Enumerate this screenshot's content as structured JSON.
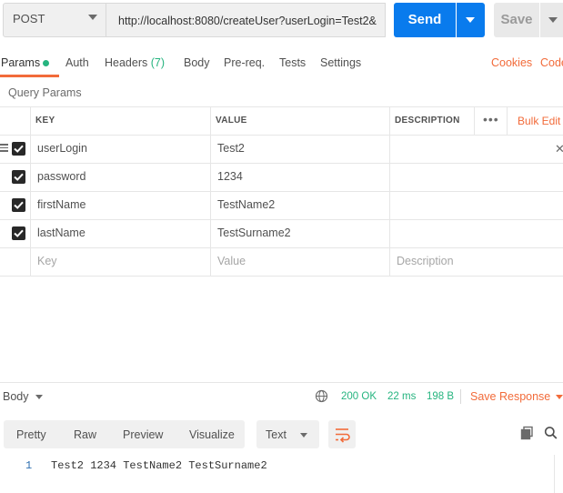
{
  "request": {
    "method": "POST",
    "url": "http://localhost:8080/createUser?userLogin=Test2&",
    "send_label": "Send",
    "save_label": "Save"
  },
  "tabs": {
    "params": "Params",
    "auth": "Auth",
    "headers": "Headers",
    "headers_count": "(7)",
    "body": "Body",
    "prereq": "Pre-req.",
    "tests": "Tests",
    "settings": "Settings",
    "cookies": "Cookies",
    "code": "Code"
  },
  "query_params": {
    "title": "Query Params",
    "columns": {
      "key": "KEY",
      "value": "VALUE",
      "description": "DESCRIPTION"
    },
    "bulk_edit": "Bulk Edit",
    "rows": [
      {
        "key": "userLogin",
        "value": "Test2",
        "checked": true
      },
      {
        "key": "password",
        "value": "1234",
        "checked": true
      },
      {
        "key": "firstName",
        "value": "TestName2",
        "checked": true
      },
      {
        "key": "lastName",
        "value": "TestSurname2",
        "checked": true
      }
    ],
    "placeholders": {
      "key": "Key",
      "value": "Value",
      "description": "Description"
    }
  },
  "response": {
    "body_label": "Body",
    "status": "200 OK",
    "time": "22 ms",
    "size": "198 B",
    "save_response": "Save Response",
    "views": {
      "pretty": "Pretty",
      "raw": "Raw",
      "preview": "Preview",
      "visualize": "Visualize"
    },
    "format": "Text",
    "line_number": "1",
    "content": "Test2 1234 TestName2 TestSurname2"
  },
  "colors": {
    "accent": "#f26b3a",
    "send_blue": "#097bed",
    "success": "#26b47f"
  }
}
